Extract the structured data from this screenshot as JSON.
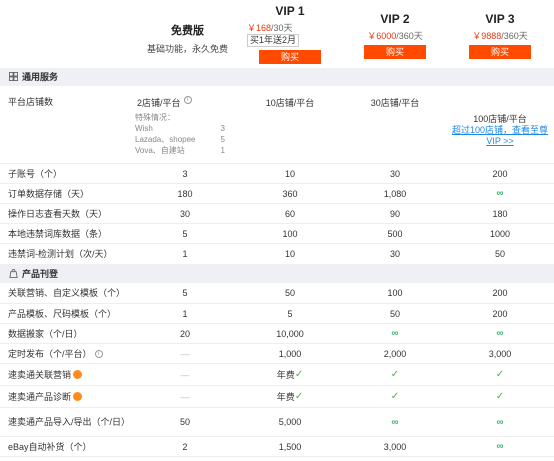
{
  "plans": {
    "free": {
      "name": "免费版",
      "desc": "基础功能，永久免费"
    },
    "vip1": {
      "name": "VIP 1",
      "price": "￥168",
      "period": "/30天",
      "promo": "买1年送2月",
      "buy": "购买"
    },
    "vip2": {
      "name": "VIP 2",
      "price": "￥6000",
      "period": "/360天",
      "buy": "购买"
    },
    "vip3": {
      "name": "VIP 3",
      "price": "￥9888",
      "period": "/360天",
      "buy": "购买"
    }
  },
  "sections": {
    "general": "通用服务",
    "products": "产品刊登"
  },
  "shop_row": {
    "label": "平台店铺数",
    "free": "2店铺/平台",
    "v1": "10店铺/平台",
    "v2": "30店铺/平台",
    "v3": "100店铺/平台",
    "v3_link": "超过100店铺，查看至尊VIP >>",
    "special_title": "特殊情况：",
    "special": [
      {
        "name": "Wish",
        "value": "3"
      },
      {
        "name": "Lazada、shopee",
        "value": "5"
      },
      {
        "name": "Vova、自建站",
        "value": "1"
      }
    ]
  },
  "general_rows": [
    {
      "label": "子账号（个）",
      "free": "3",
      "v1": "10",
      "v2": "30",
      "v3": "200"
    },
    {
      "label": "订单数据存储（天）",
      "free": "180",
      "v1": "360",
      "v2": "1,080",
      "v3": "∞"
    },
    {
      "label": "操作日志查看天数（天）",
      "free": "30",
      "v1": "60",
      "v2": "90",
      "v3": "180"
    },
    {
      "label": "本地违禁词库数据（条）",
      "free": "5",
      "v1": "100",
      "v2": "500",
      "v3": "1000"
    },
    {
      "label": "违禁词-检测计划（次/天）",
      "free": "1",
      "v1": "10",
      "v2": "30",
      "v3": "50"
    }
  ],
  "product_rows": [
    {
      "label": "关联营销、自定义模板（个）",
      "free": "5",
      "v1": "50",
      "v2": "100",
      "v3": "200"
    },
    {
      "label": "产品模板、尺码模板（个）",
      "free": "1",
      "v1": "5",
      "v2": "50",
      "v3": "200"
    },
    {
      "label": "数据搬家（个/日）",
      "free": "20",
      "v1": "10,000",
      "v2": "∞",
      "v3": "∞"
    },
    {
      "label": "定时发布（个/平台）",
      "free": "—",
      "v1": "1,000",
      "v2": "2,000",
      "v3": "3,000"
    },
    {
      "label": "速卖通关联营销",
      "free": "—",
      "v1": "年费",
      "v2": "✓",
      "v3": "✓"
    },
    {
      "label": "速卖通产品诊断",
      "free": "—",
      "v1": "年费",
      "v2": "✓",
      "v3": "✓"
    },
    {
      "label": "速卖通产品导入/导出（个/日）",
      "free": "50",
      "v1": "5,000",
      "v2": "∞",
      "v3": "∞"
    },
    {
      "label": "eBay自动补货（个）",
      "free": "2",
      "v1": "1,500",
      "v2": "3,000",
      "v3": "∞"
    }
  ]
}
